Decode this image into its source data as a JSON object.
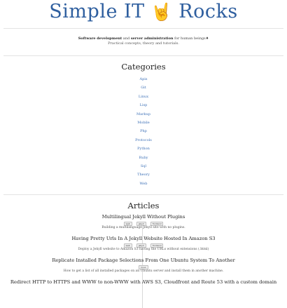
{
  "header": {
    "title_left": "Simple IT",
    "title_right": "Rocks",
    "hand_glyph": "🤘",
    "hand_icon": "rock-hand-icon",
    "brand_color": "#2f5f9f"
  },
  "intro": {
    "part1": "Software development",
    "part2": " and ",
    "part3": "server administration",
    "part4": " for human beings",
    "part5": "♦",
    "line2": "Practical concepts, theory and tutorials."
  },
  "categories": {
    "heading": "Categories",
    "items": [
      "Apis",
      "Git",
      "Linux",
      "Lisp",
      "Markup",
      "Mobile",
      "Php",
      "Protocols",
      "Python",
      "Ruby",
      "Sql",
      "Theory",
      "Web"
    ]
  },
  "articles": {
    "heading": "Articles",
    "items": [
      {
        "title": "Multilingual Jekyll Without Plugins",
        "tags": [
          "web",
          "jekyll",
          "frontend"
        ],
        "desc": "Building a multilanguage Jekyll site with no plugins."
      },
      {
        "title": "Having Pretty Urls In A Jekyll Website Hosted In Amazon S3",
        "tags": [
          "web",
          "jekyll",
          "frontend"
        ],
        "desc": "Deploy a Jekyll website to Amazon S3 having the URLs without extensions (.html)"
      },
      {
        "title": "Replicate Installed Package Selections From One Ubuntu System To Another",
        "tags": [
          "linux"
        ],
        "desc": "How to get a list of all installed packages on an Ubuntu server and install them in another machine."
      },
      {
        "title": "Redirect HTTP to HTTPS and WWW to non-WWW with AWS S3, Cloudfront and Route 53 with a custom domain",
        "tags": [],
        "desc": ""
      }
    ]
  }
}
